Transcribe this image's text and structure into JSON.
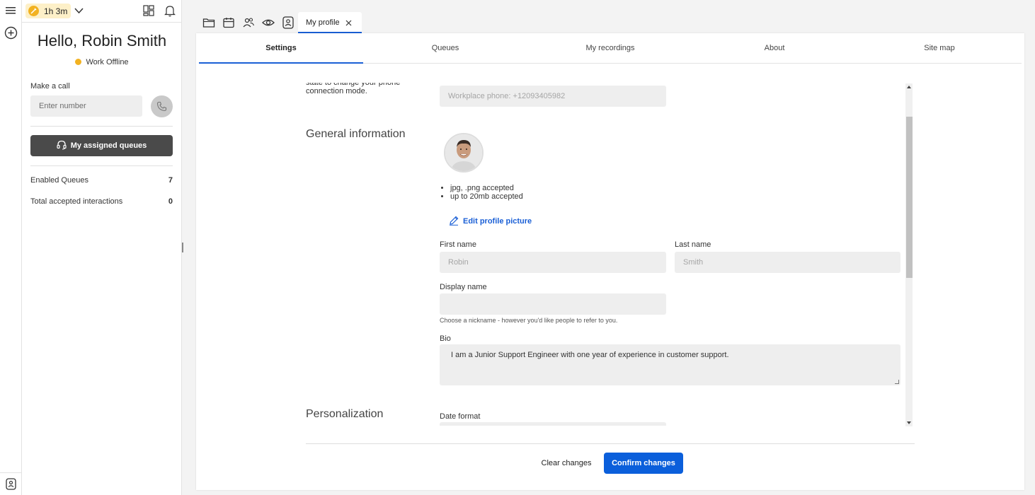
{
  "rail": {
    "menu_icon": "hamburger-icon",
    "add_icon": "plus-circle-icon",
    "bottom_icon": "contact-card-icon"
  },
  "panel": {
    "timer": "1h 3m",
    "greeting": "Hello, Robin Smith",
    "status": "Work Offline",
    "make_call_label": "Make a call",
    "number_placeholder": "Enter number",
    "assigned_queues_button": "My assigned queues",
    "stats": [
      {
        "label": "Enabled Queues",
        "value": "7"
      },
      {
        "label": "Total accepted interactions",
        "value": "0"
      }
    ],
    "status_color": "#f2b221"
  },
  "toolbar": {
    "icons": [
      "folder-icon",
      "calendar-icon",
      "people-icon",
      "eye-icon",
      "contact-card-icon"
    ],
    "open_tab": "My profile"
  },
  "tabs": [
    {
      "label": "Settings",
      "active": true
    },
    {
      "label": "Queues",
      "active": false
    },
    {
      "label": "My recordings",
      "active": false
    },
    {
      "label": "About",
      "active": false
    },
    {
      "label": "Site map",
      "active": false
    }
  ],
  "content": {
    "phone_help_partial": "state to change your phone connection mode.",
    "workplace_phone": "Workplace phone: +12093405982",
    "general_info_title": "General information",
    "picture_rules": [
      "jpg, .png accepted",
      "up to 20mb accepted"
    ],
    "edit_picture_link": "Edit profile picture",
    "first_name_label": "First name",
    "first_name_value": "Robin",
    "last_name_label": "Last name",
    "last_name_value": "Smith",
    "display_name_label": "Display name",
    "display_name_value": "",
    "display_name_hint": "Choose a nickname - however you'd like people to refer to you.",
    "bio_label": "Bio",
    "bio_value": "I am a Junior Support Engineer with one year of experience in customer support.",
    "personalization_title": "Personalization",
    "date_format_label": "Date format"
  },
  "footer": {
    "clear_button": "Clear changes",
    "confirm_button": "Confirm changes",
    "accent_color": "#0b5fdb"
  }
}
